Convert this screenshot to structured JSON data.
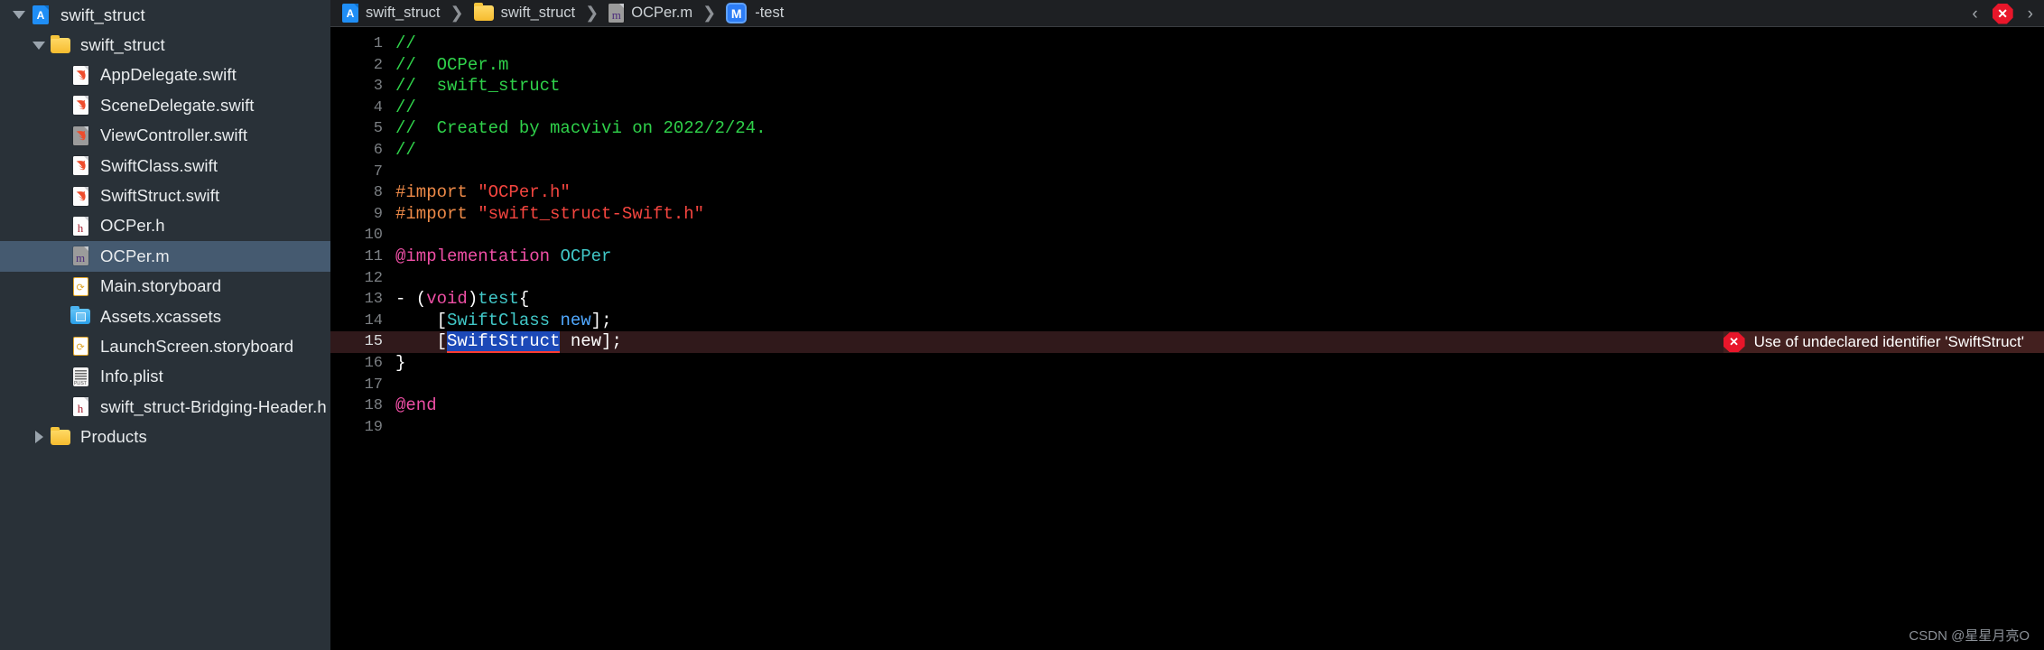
{
  "sidebar": {
    "items": [
      {
        "label": "swift_struct",
        "icon": "xcode-project-icon",
        "indent": 0,
        "disclosure": "down",
        "selected": false
      },
      {
        "label": "swift_struct",
        "icon": "folder-icon",
        "indent": 1,
        "disclosure": "down",
        "selected": false
      },
      {
        "label": "AppDelegate.swift",
        "icon": "swift-file-icon",
        "indent": 2,
        "disclosure": "none",
        "selected": false
      },
      {
        "label": "SceneDelegate.swift",
        "icon": "swift-file-icon",
        "indent": 2,
        "disclosure": "none",
        "selected": false
      },
      {
        "label": "ViewController.swift",
        "icon": "swift-file-grey-icon",
        "indent": 2,
        "disclosure": "none",
        "selected": false
      },
      {
        "label": "SwiftClass.swift",
        "icon": "swift-file-icon",
        "indent": 2,
        "disclosure": "none",
        "selected": false
      },
      {
        "label": "SwiftStruct.swift",
        "icon": "swift-file-icon",
        "indent": 2,
        "disclosure": "none",
        "selected": false
      },
      {
        "label": "OCPer.h",
        "icon": "header-file-icon",
        "indent": 2,
        "disclosure": "none",
        "selected": false
      },
      {
        "label": "OCPer.m",
        "icon": "objc-file-icon",
        "indent": 2,
        "disclosure": "none",
        "selected": true
      },
      {
        "label": "Main.storyboard",
        "icon": "storyboard-icon",
        "indent": 2,
        "disclosure": "none",
        "selected": false
      },
      {
        "label": "Assets.xcassets",
        "icon": "assets-folder-icon",
        "indent": 2,
        "disclosure": "none",
        "selected": false
      },
      {
        "label": "LaunchScreen.storyboard",
        "icon": "storyboard-icon",
        "indent": 2,
        "disclosure": "none",
        "selected": false
      },
      {
        "label": "Info.plist",
        "icon": "plist-file-icon",
        "indent": 2,
        "disclosure": "none",
        "selected": false
      },
      {
        "label": "swift_struct-Bridging-Header.h",
        "icon": "header-file-icon",
        "indent": 2,
        "disclosure": "none",
        "selected": false
      },
      {
        "label": "Products",
        "icon": "folder-icon",
        "indent": 1,
        "disclosure": "right",
        "selected": false
      }
    ]
  },
  "jumpbar": {
    "crumbs": [
      {
        "label": "swift_struct",
        "icon": "xcode-project-icon"
      },
      {
        "label": "swift_struct",
        "icon": "folder-icon"
      },
      {
        "label": "OCPer.m",
        "icon": "objc-file-icon"
      },
      {
        "label": "-test",
        "icon": "method-badge-m"
      }
    ],
    "separator": "❯",
    "method_badge": "M",
    "back_chevron": "‹",
    "forward_chevron": "›",
    "error_glyph": "✕"
  },
  "editor": {
    "lines": [
      {
        "n": "1",
        "segments": [
          {
            "t": "//",
            "c": "cm"
          }
        ]
      },
      {
        "n": "2",
        "segments": [
          {
            "t": "//  OCPer.m",
            "c": "cm"
          }
        ]
      },
      {
        "n": "3",
        "segments": [
          {
            "t": "//  swift_struct",
            "c": "cm"
          }
        ]
      },
      {
        "n": "4",
        "segments": [
          {
            "t": "//",
            "c": "cm"
          }
        ]
      },
      {
        "n": "5",
        "segments": [
          {
            "t": "//  Created by macvivi on 2022/2/24.",
            "c": "cm"
          }
        ]
      },
      {
        "n": "6",
        "segments": [
          {
            "t": "//",
            "c": "cm"
          }
        ]
      },
      {
        "n": "7",
        "segments": []
      },
      {
        "n": "8",
        "segments": [
          {
            "t": "#import ",
            "c": "pp"
          },
          {
            "t": "\"OCPer.h\"",
            "c": "str"
          }
        ]
      },
      {
        "n": "9",
        "segments": [
          {
            "t": "#import ",
            "c": "pp"
          },
          {
            "t": "\"swift_struct-Swift.h\"",
            "c": "str"
          }
        ]
      },
      {
        "n": "10",
        "segments": []
      },
      {
        "n": "11",
        "segments": [
          {
            "t": "@implementation ",
            "c": "kw"
          },
          {
            "t": "OCPer",
            "c": "ty"
          }
        ]
      },
      {
        "n": "12",
        "segments": []
      },
      {
        "n": "13",
        "segments": [
          {
            "t": "- (",
            "c": ""
          },
          {
            "t": "void",
            "c": "kw"
          },
          {
            "t": ")",
            "c": ""
          },
          {
            "t": "test",
            "c": "ty"
          },
          {
            "t": "{",
            "c": ""
          }
        ]
      },
      {
        "n": "14",
        "segments": [
          {
            "t": "    [",
            "c": ""
          },
          {
            "t": "SwiftClass",
            "c": "ty"
          },
          {
            "t": " ",
            "c": ""
          },
          {
            "t": "new",
            "c": "blu"
          },
          {
            "t": "];",
            "c": ""
          }
        ]
      },
      {
        "n": "15",
        "segments": [
          {
            "t": "    [",
            "c": ""
          },
          {
            "t": "SwiftStruct",
            "c": "sel"
          },
          {
            "t": " new];",
            "c": ""
          }
        ],
        "error": true
      },
      {
        "n": "16",
        "segments": [
          {
            "t": "}",
            "c": ""
          }
        ]
      },
      {
        "n": "17",
        "segments": []
      },
      {
        "n": "18",
        "segments": [
          {
            "t": "@end",
            "c": "kw"
          }
        ]
      },
      {
        "n": "19",
        "segments": []
      }
    ],
    "error_message": "Use of undeclared identifier 'SwiftStruct'",
    "error_badge": "✕"
  },
  "watermark": "CSDN @星星月亮O",
  "colors": {
    "sidebar_bg": "#293138",
    "selection_bg": "#455a70",
    "editor_bg": "#000000",
    "comment_green": "#2fd14a",
    "preprocessor_orange": "#ee8a48",
    "string_red": "#f4453f",
    "keyword_pink": "#ef4fa5",
    "type_cyan": "#41c7c7",
    "error_red": "#e8162a",
    "error_line_bg": "#30191b",
    "selected_token_bg": "#1c49b8",
    "badge_blue": "#2d7df6"
  }
}
